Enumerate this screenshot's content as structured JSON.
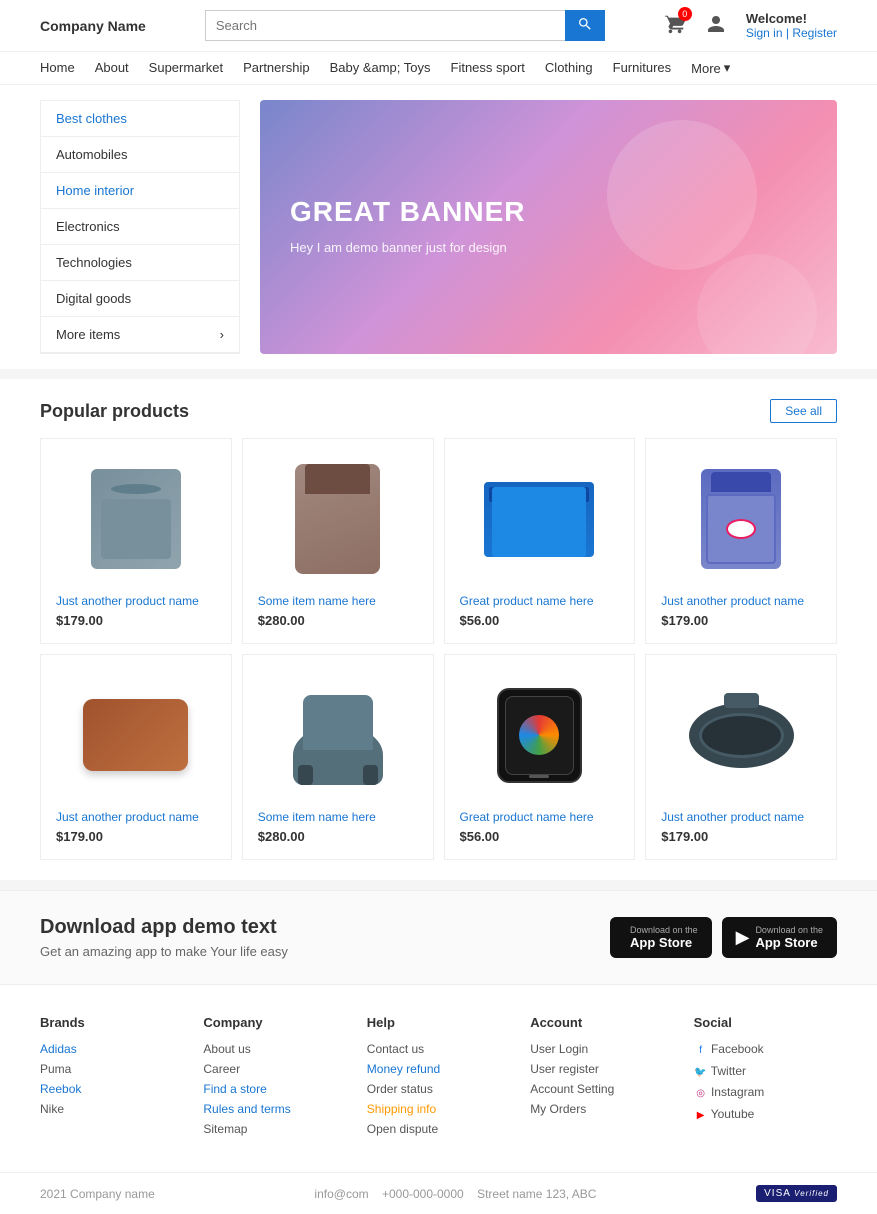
{
  "header": {
    "logo": "Company Name",
    "search_placeholder": "Search",
    "cart_badge": "0",
    "welcome": "Welcome!",
    "sign_in": "Sign in",
    "register": "Register"
  },
  "nav": {
    "items": [
      {
        "label": "Home"
      },
      {
        "label": "About"
      },
      {
        "label": "Supermarket"
      },
      {
        "label": "Partnership"
      },
      {
        "label": "Baby &amp; Toys"
      },
      {
        "label": "Fitness sport"
      },
      {
        "label": "Clothing"
      },
      {
        "label": "Furnitures"
      },
      {
        "label": "More"
      }
    ]
  },
  "sidebar": {
    "items": [
      {
        "label": "Best clothes",
        "type": "link"
      },
      {
        "label": "Automobiles",
        "type": "normal"
      },
      {
        "label": "Home interior",
        "type": "link"
      },
      {
        "label": "Electronics",
        "type": "normal"
      },
      {
        "label": "Technologies",
        "type": "normal"
      },
      {
        "label": "Digital goods",
        "type": "normal"
      },
      {
        "label": "More items",
        "type": "more"
      }
    ]
  },
  "banner": {
    "title": "GREAT BANNER",
    "subtitle": "Hey I am demo banner just for design"
  },
  "products": {
    "section_title": "Popular products",
    "see_all": "See all",
    "items": [
      {
        "name": "Just another product name",
        "price": "$179.00",
        "img": "polo"
      },
      {
        "name": "Some item name here",
        "price": "$280.00",
        "img": "jacket"
      },
      {
        "name": "Great product name here",
        "price": "$56.00",
        "img": "shorts"
      },
      {
        "name": "Just another product name",
        "price": "$179.00",
        "img": "backpack"
      },
      {
        "name": "Just another product name",
        "price": "$179.00",
        "img": "leather"
      },
      {
        "name": "Some item name here",
        "price": "$280.00",
        "img": "chair"
      },
      {
        "name": "Great product name here",
        "price": "$56.00",
        "img": "watch"
      },
      {
        "name": "Just another product name",
        "price": "$179.00",
        "img": "headphones"
      }
    ]
  },
  "download": {
    "title": "Download app demo text",
    "subtitle": "Get an amazing app to make Your life easy",
    "btn1_top": "Download on the",
    "btn1_bottom": "App Store",
    "btn2_top": "Download on the",
    "btn2_bottom": "App Store"
  },
  "footer": {
    "brands": {
      "heading": "Brands",
      "links": [
        "Adidas",
        "Puma",
        "Reebok",
        "Nike"
      ]
    },
    "company": {
      "heading": "Company",
      "links": [
        {
          "label": "About us",
          "type": "normal"
        },
        {
          "label": "Career",
          "type": "normal"
        },
        {
          "label": "Find a store",
          "type": "link"
        },
        {
          "label": "Rules and terms",
          "type": "link"
        },
        {
          "label": "Sitemap",
          "type": "normal"
        }
      ]
    },
    "help": {
      "heading": "Help",
      "links": [
        {
          "label": "Contact us",
          "type": "normal"
        },
        {
          "label": "Money refund",
          "type": "link"
        },
        {
          "label": "Order status",
          "type": "normal"
        },
        {
          "label": "Shipping info",
          "type": "orange"
        },
        {
          "label": "Open dispute",
          "type": "normal"
        }
      ]
    },
    "account": {
      "heading": "Account",
      "links": [
        {
          "label": "User Login",
          "type": "normal"
        },
        {
          "label": "User register",
          "type": "normal"
        },
        {
          "label": "Account Setting",
          "type": "normal"
        },
        {
          "label": "My Orders",
          "type": "normal"
        }
      ]
    },
    "social": {
      "heading": "Social",
      "links": [
        {
          "label": "Facebook",
          "icon": "fb"
        },
        {
          "label": "Twitter",
          "icon": "tw"
        },
        {
          "label": "Instagram",
          "icon": "ig"
        },
        {
          "label": "Youtube",
          "icon": "yt"
        }
      ]
    }
  },
  "footer_bottom": {
    "copyright": "2021 Company name",
    "email": "info@com",
    "phone": "+000-000-0000",
    "address": "Street name 123, ABC",
    "visa": "VISA"
  }
}
